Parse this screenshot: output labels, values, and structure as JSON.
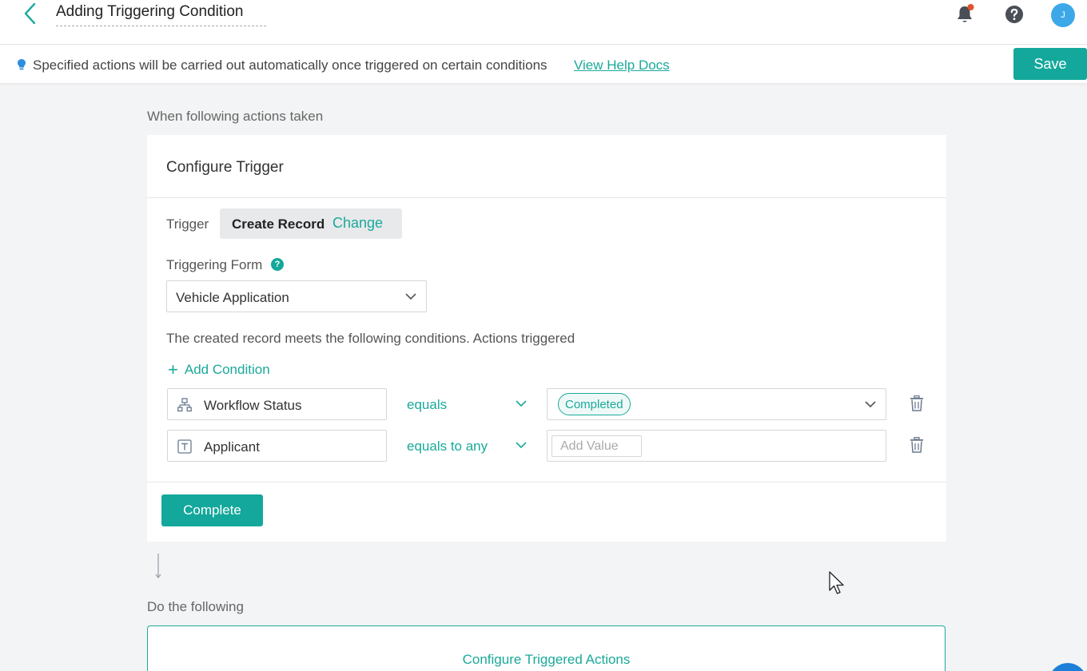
{
  "header": {
    "title": "Adding Triggering Condition",
    "avatar_initial": "J",
    "notification_dot_color": "#e0522d"
  },
  "infobar": {
    "message": "Specified actions will be carried out automatically once triggered on certain conditions",
    "help_link": "View Help Docs",
    "save_label": "Save"
  },
  "trigger_section": {
    "label": "When following actions taken",
    "card_title": "Configure Trigger",
    "trigger_label": "Trigger",
    "trigger_value": "Create Record",
    "change_label": "Change",
    "form_label": "Triggering Form",
    "form_help": "?",
    "form_value": "Vehicle Application",
    "conditions_description": "The created record meets the following conditions. Actions triggered",
    "add_condition_label": "Add Condition",
    "conditions": [
      {
        "field": "Workflow Status",
        "field_icon": "workflow-icon",
        "operator": "equals",
        "value_tag": "Completed"
      },
      {
        "field": "Applicant",
        "field_icon": "text-field-icon",
        "operator": "equals to any",
        "value_placeholder": "Add Value"
      }
    ],
    "complete_label": "Complete"
  },
  "actions_section": {
    "label": "Do the following",
    "configure_label": "Configure Triggered Actions"
  },
  "colors": {
    "accent": "#13a89b",
    "link": "#1aa99a",
    "background": "#f3f4f5",
    "avatar": "#3da8e8"
  }
}
